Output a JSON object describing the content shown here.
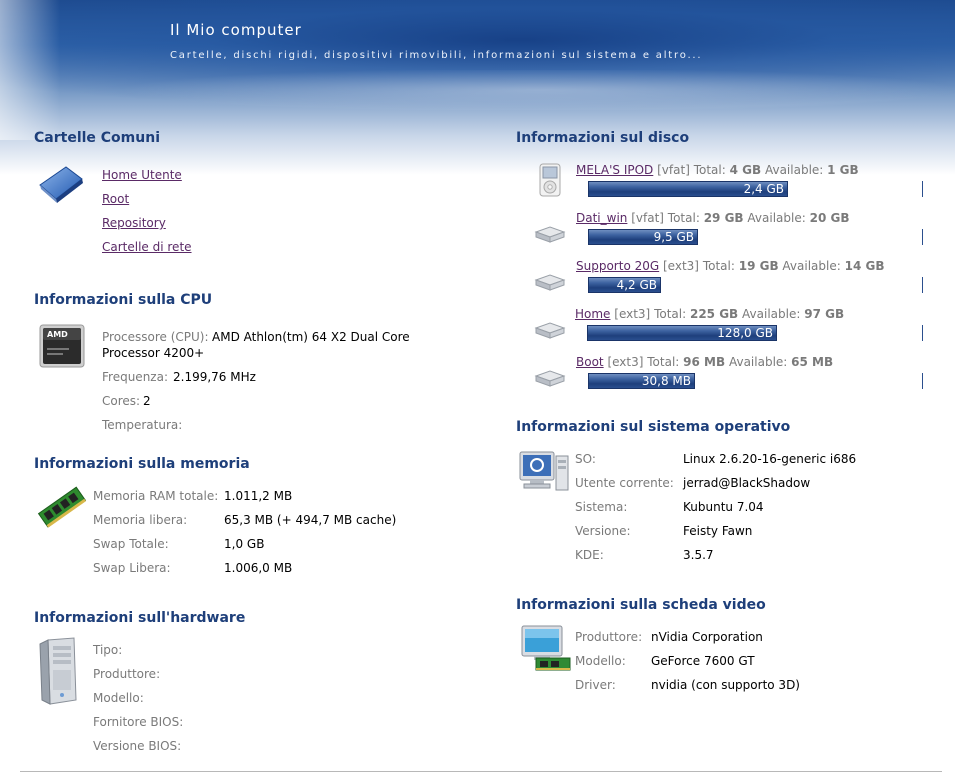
{
  "header": {
    "title": "Il Mio computer",
    "subtitle": "Cartelle, dischi rigidi, dispositivi rimovibili, informazioni sul sistema e altro..."
  },
  "common_folders": {
    "title": "Cartelle Comuni",
    "icon": "folder-icon",
    "links": [
      "Home Utente",
      "Root",
      "Repository",
      "Cartelle di rete"
    ]
  },
  "cpu": {
    "title": "Informazioni sulla CPU",
    "icon": "amd-cpu-icon",
    "processor_label": "Processore (CPU):",
    "processor_value_1": "AMD Athlon(tm) 64 X2 Dual Core",
    "processor_value_2": "Processor 4200+",
    "frequency_label": "Frequenza:",
    "frequency_value": "2.199,76 MHz",
    "cores_label": "Cores:",
    "cores_value": "2",
    "temperature_label": "Temperatura:"
  },
  "memory": {
    "title": "Informazioni sulla memoria",
    "icon": "ram-module-icon",
    "rows": [
      {
        "label": "Memoria RAM totale:",
        "value": "1.011,2 MB"
      },
      {
        "label": "Memoria libera:",
        "value": "65,3 MB (+ 494,7 MB cache)"
      },
      {
        "label": "Swap Totale:",
        "value": "1,0 GB"
      },
      {
        "label": "Swap Libera:",
        "value": "1.006,0 MB"
      }
    ]
  },
  "hardware": {
    "title": "Informazioni sull'hardware",
    "icon": "computer-tower-icon",
    "labels": [
      "Tipo:",
      "Produttore:",
      "Modello:",
      "Fornitore BIOS:",
      "Versione BIOS:"
    ]
  },
  "disk": {
    "title": "Informazioni sul disco",
    "total_label": "Total:",
    "available_label": "Available:",
    "items": [
      {
        "name": "MELA'S IPOD",
        "fs": "[vfat]",
        "total": "4 GB",
        "available": "1 GB",
        "used": "2,4 GB",
        "used_fraction": 0.6,
        "icon": "ipod-icon"
      },
      {
        "name": "Dati_win",
        "fs": "[vfat]",
        "total": "29 GB",
        "available": "20 GB",
        "used": "9,5 GB",
        "used_fraction": 0.33,
        "icon": "hard-disk-icon"
      },
      {
        "name": "Supporto 20G",
        "fs": "[ext3]",
        "total": "19 GB",
        "available": "14 GB",
        "used": "4,2 GB",
        "used_fraction": 0.22,
        "icon": "hard-disk-icon"
      },
      {
        "name": "Home",
        "fs": "[ext3]",
        "total": "225 GB",
        "available": "97 GB",
        "used": "128,0 GB",
        "used_fraction": 0.57,
        "icon": "hard-disk-icon"
      },
      {
        "name": "Boot",
        "fs": "[ext3]",
        "total": "96 MB",
        "available": "65 MB",
        "used": "30,8 MB",
        "used_fraction": 0.32,
        "icon": "hard-disk-icon"
      }
    ]
  },
  "os": {
    "title": "Informazioni sul sistema operativo",
    "icon": "computer-kde-icon",
    "rows": [
      {
        "label": "SO:",
        "value": "Linux 2.6.20-16-generic i686"
      },
      {
        "label": "Utente corrente:",
        "value": "jerrad@BlackShadow"
      },
      {
        "label": "Sistema:",
        "value": "Kubuntu 7.04"
      },
      {
        "label": "Versione:",
        "value": "Feisty Fawn"
      },
      {
        "label": "KDE:",
        "value": "3.5.7"
      }
    ]
  },
  "video": {
    "title": "Informazioni sulla scheda video",
    "icon": "video-card-icon",
    "rows": [
      {
        "label": "Produttore:",
        "value": "nVidia Corporation"
      },
      {
        "label": "Modello:",
        "value": "GeForce 7600 GT"
      },
      {
        "label": "Driver:",
        "value": "nvidia (con supporto 3D)"
      }
    ]
  }
}
